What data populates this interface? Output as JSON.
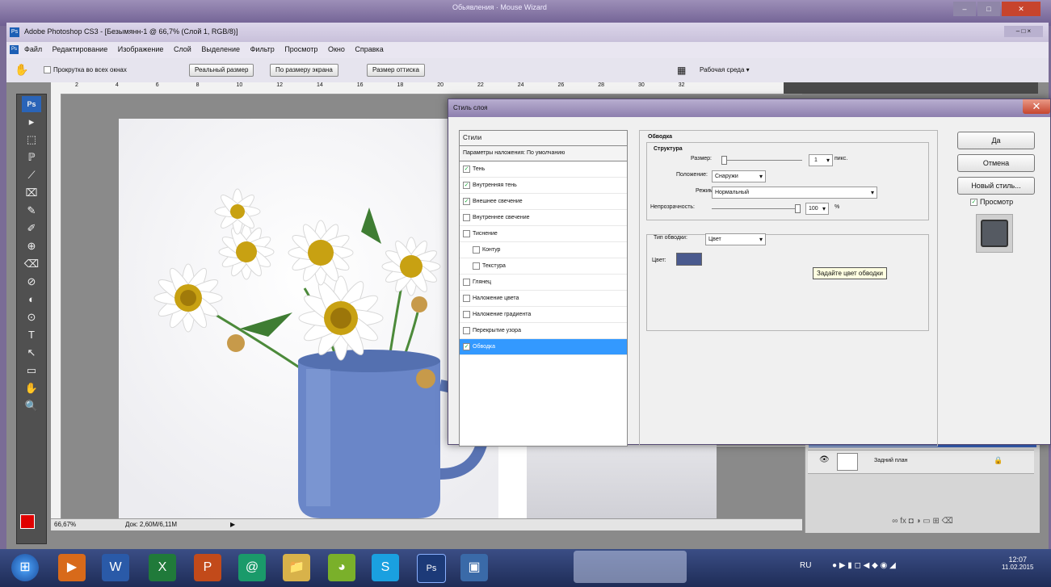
{
  "window": {
    "top_caption": "Обьявления · Mouse Wizard",
    "title": "Adobe Photoshop CS3 - [Безымянн-1 @ 66,7% (Слой 1, RGB/8)]",
    "ctrl_min": "–",
    "ctrl_max": "□",
    "ctrl_close": "✕",
    "doc_ctrls": "– □ ×"
  },
  "menu": {
    "app_icon": "Ps",
    "items": [
      "Файл",
      "Редактирование",
      "Изображение",
      "Слой",
      "Выделение",
      "Фильтр",
      "Просмотр",
      "Окно",
      "Справка"
    ]
  },
  "options": {
    "checkbox_label": "Прокрутка во всех окнах",
    "actual_pixels": "Реальный размер",
    "fit_screen": "По размеру экрана",
    "print_size": "Размер оттиска",
    "workspace": "Рабочая среда ▾"
  },
  "ruler": {
    "ticks": [
      "2",
      "4",
      "6",
      "8",
      "10",
      "12",
      "14",
      "16",
      "18",
      "20",
      "22",
      "24",
      "26",
      "28",
      "30",
      "32"
    ]
  },
  "status": {
    "zoom": "66,67%",
    "doc_size": "Док: 2,60М/6,11М",
    "arrow": "▶"
  },
  "tools": [
    "▸",
    "⬚",
    "ℙ",
    "⟋",
    "⌧",
    "✎",
    "✐",
    "⊕",
    "⌫",
    "⊘",
    "◐",
    "⊙",
    "T",
    "↖",
    "▭",
    "✋",
    "🔍"
  ],
  "dialog": {
    "title": "Стиль слоя",
    "close_glyph": "✕",
    "styles_header": "Стили",
    "blend_options": "Параметры наложения: По умолчанию",
    "style_items": [
      {
        "label": "Тень",
        "checked": true,
        "indent": false
      },
      {
        "label": "Внутренняя тень",
        "checked": true,
        "indent": false
      },
      {
        "label": "Внешнее свечение",
        "checked": true,
        "indent": false
      },
      {
        "label": "Внутреннее свечение",
        "checked": false,
        "indent": false
      },
      {
        "label": "Тиснение",
        "checked": false,
        "indent": false
      },
      {
        "label": "Контур",
        "checked": false,
        "indent": true
      },
      {
        "label": "Текстура",
        "checked": false,
        "indent": true
      },
      {
        "label": "Глянец",
        "checked": false,
        "indent": false
      },
      {
        "label": "Наложение цвета",
        "checked": false,
        "indent": false
      },
      {
        "label": "Наложение градиента",
        "checked": false,
        "indent": false
      },
      {
        "label": "Перекрытие узора",
        "checked": false,
        "indent": false
      },
      {
        "label": "Обводка",
        "checked": true,
        "indent": false,
        "selected": true
      }
    ],
    "stroke": {
      "section_title": "Обводка",
      "structure_title": "Структура",
      "size_label": "Размер:",
      "size_value": "1",
      "size_unit": "пикс.",
      "position_label": "Положение:",
      "position_value": "Снаружи",
      "blend_label": "Режим:",
      "blend_value": "Нормальный",
      "opacity_label": "Непрозрачность:",
      "opacity_value": "100",
      "opacity_unit": "%",
      "fill_type_label": "Тип обводки:",
      "fill_type_value": "Цвет",
      "color_label": "Цвет:",
      "color_hex": "#4a5a8e",
      "tooltip": "Задайте цвет обводки"
    },
    "buttons": {
      "ok": "Да",
      "cancel": "Отмена",
      "new_style": "Новый стиль...",
      "preview": "Просмотр"
    }
  },
  "layers": {
    "eye": "👁",
    "bg_layer": "Задний план",
    "lock": "🔒",
    "footer_icons": "∞ fx ◘ ◑ ▭ ⊞ ⌫"
  },
  "taskbar": {
    "lang": "RU",
    "time": "12:07",
    "date": "11.02.2015",
    "apps": [
      "⊞",
      "▶",
      "W",
      "X",
      "P",
      "@",
      "📁",
      "◕",
      "S",
      "Ps",
      "▣"
    ]
  },
  "colors": {
    "foreground": "#e00000",
    "selection": "#3399ff",
    "mug": "#6a86c8"
  }
}
